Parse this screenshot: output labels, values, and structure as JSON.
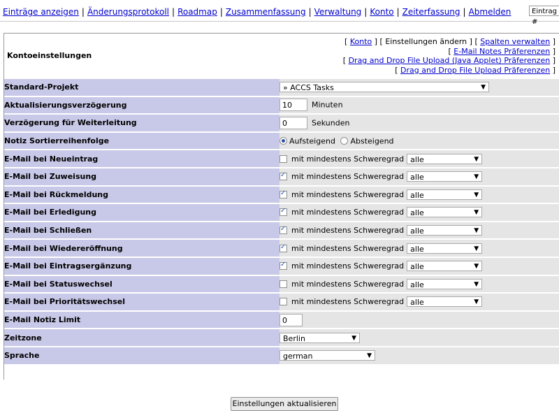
{
  "nav": {
    "items": [
      "Einträge anzeigen",
      "Änderungsprotokoll",
      "Roadmap",
      "Zusammenfassung",
      "Verwaltung",
      "Konto",
      "Zeiterfassung",
      "Abmelden"
    ],
    "separator": "|",
    "jump_placeholder": "Eintrag #"
  },
  "header": {
    "title": "Kontoeinstellungen",
    "links": {
      "konto": "Konto",
      "current": "Einstellungen ändern",
      "columns": "Spalten verwalten",
      "email_notes": "E-Mail Notes Präferenzen",
      "dnd_applet": "Drag and Drop File Upload (Java Applet) Präferenzen",
      "dnd": "Drag and Drop File Upload Präferenzen"
    }
  },
  "form": {
    "default_project": {
      "label": "Standard-Projekt",
      "value": "» ACCS Tasks"
    },
    "refresh_delay": {
      "label": "Aktualisierungsverzögerung",
      "value": "10",
      "unit": "Minuten"
    },
    "redirect_delay": {
      "label": "Verzögerung für Weiterleitung",
      "value": "0",
      "unit": "Sekunden"
    },
    "note_order": {
      "label": "Notiz Sortierreihenfolge",
      "asc": "Aufsteigend",
      "desc": "Absteigend"
    },
    "severity_text": "mit mindestens Schweregrad",
    "email_rows": [
      {
        "label": "E-Mail bei Neueintrag",
        "checked": false,
        "severity": "alle"
      },
      {
        "label": "E-Mail bei Zuweisung",
        "checked": true,
        "severity": "alle"
      },
      {
        "label": "E-Mail bei Rückmeldung",
        "checked": true,
        "severity": "alle"
      },
      {
        "label": "E-Mail bei Erledigung",
        "checked": true,
        "severity": "alle"
      },
      {
        "label": "E-Mail bei Schließen",
        "checked": true,
        "severity": "alle"
      },
      {
        "label": "E-Mail bei Wiedereröffnung",
        "checked": true,
        "severity": "alle"
      },
      {
        "label": "E-Mail bei Eintragsergänzung",
        "checked": true,
        "severity": "alle"
      },
      {
        "label": "E-Mail bei Statuswechsel",
        "checked": false,
        "severity": "alle"
      },
      {
        "label": "E-Mail bei Prioritätswechsel",
        "checked": false,
        "severity": "alle"
      }
    ],
    "email_limit": {
      "label": "E-Mail Notiz Limit",
      "value": "0"
    },
    "timezone": {
      "label": "Zeitzone",
      "value": "Berlin"
    },
    "language": {
      "label": "Sprache",
      "value": "german"
    },
    "submit": "Einstellungen aktualisieren"
  }
}
